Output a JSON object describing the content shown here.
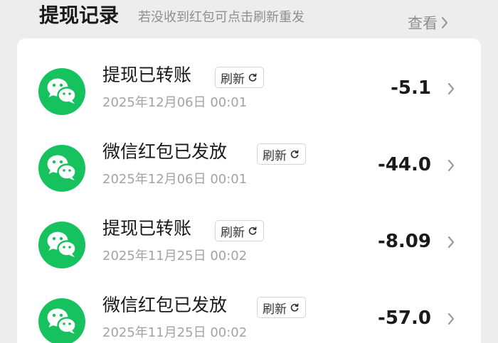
{
  "header": {
    "title": "提现记录",
    "subtitle": "若没收到红包可点击刷新重发",
    "view_label": "查看"
  },
  "records": [
    {
      "title": "提现已转账",
      "refresh_label": "刷新",
      "time": "2025年12月06日 00:01",
      "amount": "-5.1"
    },
    {
      "title": "微信红包已发放",
      "refresh_label": "刷新",
      "time": "2025年12月06日 00:01",
      "amount": "-44.0"
    },
    {
      "title": "提现已转账",
      "refresh_label": "刷新",
      "time": "2025年11月25日 00:02",
      "amount": "-8.09"
    },
    {
      "title": "微信红包已发放",
      "refresh_label": "刷新",
      "time": "2025年11月25日 00:02",
      "amount": "-57.0"
    }
  ],
  "icons": {
    "avatar": "wechat-icon",
    "refresh": "refresh-icon",
    "chevron": "chevron-right-icon"
  },
  "colors": {
    "accent_green": "#15c25d",
    "background": "#ededed",
    "card": "#ffffff"
  }
}
